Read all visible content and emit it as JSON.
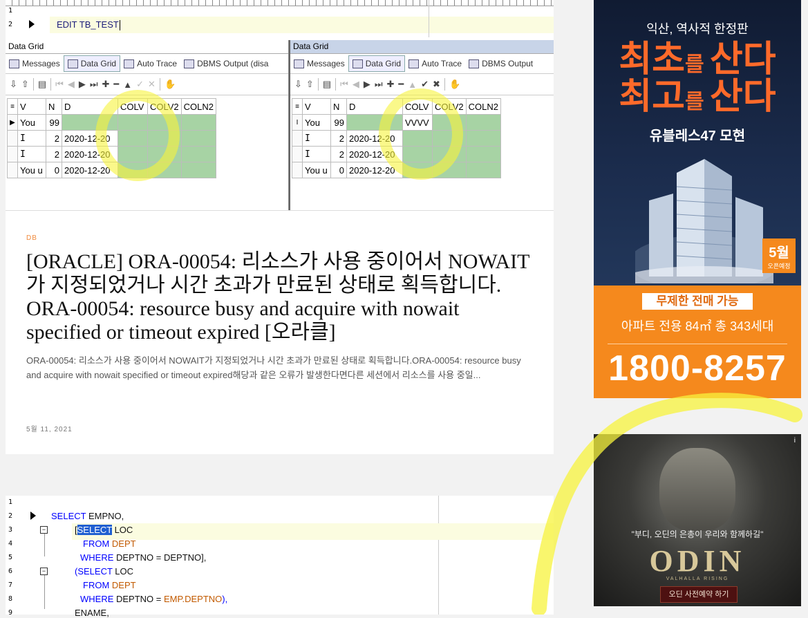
{
  "post1": {
    "category": "DB",
    "title": "[ORACLE] ORA-00054: 리소스가 사용 중이어서 NOWAIT가 지정되었거나 시간 초과가 만료된 상태로 획득합니다. ORA-00054: resource busy and acquire with nowait specified or timeout expired [오라클]",
    "excerpt": "ORA-00054: 리소스가 사용 중이어서 NOWAIT가 지정되었거나 시간 초과가 만료된 상태로 획득합니다.ORA-00054: resource busy and acquire with nowait specified or timeout expired해당과 같은 오류가 발생한다면다른 세션에서 리소스를 사용 중일...",
    "date": "5월 11, 2021",
    "editor": {
      "line1": "1",
      "line2": "2",
      "code": "EDIT TB_TEST"
    },
    "left_pane": {
      "title": "Data Grid",
      "tabs": [
        "Messages",
        "Data Grid",
        "Auto Trace",
        "DBMS Output (disa"
      ],
      "columns": [
        "V",
        "N",
        "D",
        "COLV",
        "COLV2",
        "COLN2"
      ],
      "rows": [
        [
          "You",
          "99",
          "",
          "",
          "",
          ""
        ],
        [
          "I",
          "2",
          "2020-12-20",
          "",
          "",
          ""
        ],
        [
          "I",
          "2",
          "2020-12-20",
          "",
          "",
          ""
        ],
        [
          "You u",
          "0",
          "2020-12-20",
          "",
          "",
          ""
        ]
      ]
    },
    "right_pane": {
      "title": "Data Grid",
      "tabs": [
        "Messages",
        "Data Grid",
        "Auto Trace",
        "DBMS Output"
      ],
      "columns": [
        "V",
        "N",
        "D",
        "COLV",
        "COLV2",
        "COLN2"
      ],
      "rows": [
        [
          "You",
          "99",
          "",
          "VVVV",
          "",
          ""
        ],
        [
          "I",
          "2",
          "2020-12-20",
          "",
          "",
          ""
        ],
        [
          "I",
          "2",
          "2020-12-20",
          "",
          "",
          ""
        ],
        [
          "You u",
          "0",
          "2020-12-20",
          "",
          "",
          ""
        ]
      ]
    }
  },
  "post2": {
    "line_numbers": [
      "1",
      "2",
      "3",
      "4",
      "5",
      "6",
      "7",
      "8",
      "9"
    ],
    "sql": {
      "l2_kw": "SELECT",
      "l2_id": " EMPNO,",
      "l3_sel": "SELECT",
      "l3_id": " LOC",
      "l4_kw": "FROM",
      "l4_obj": " DEPT",
      "l5_kw": "WHERE",
      "l5_id": " DEPTNO = DEPTNO",
      "l6_kw": "(SELECT",
      "l6_id": " LOC",
      "l7_kw": "FROM",
      "l7_obj": " DEPT",
      "l8_kw": "WHERE",
      "l8_id": " DEPTNO = ",
      "l8_obj": "EMP.DEPTNO",
      "l9_id": "ENAME,"
    }
  },
  "ad1": {
    "subtitle": "익산, 역사적 한정판",
    "line1_big": "최초",
    "line1_small": "를 ",
    "line1_end": "산다",
    "line2_big": "최고",
    "line2_small": "를 ",
    "line2_end": "산다",
    "brand": "유블레스47 모현",
    "month": "5월",
    "month_sub": "오픈예정",
    "box": "무제한 전매 가능",
    "info": "아파트 전용 84㎡ 총 343세대",
    "phone": "1800-8257"
  },
  "ad2": {
    "info_mark": "i",
    "quote": "\"부디, 오딘의 은총이 우리와 함께하길\"",
    "logo": "ODIN",
    "logo_sub": "VALHALLA RISING",
    "button": "오딘 사전예약 하기"
  },
  "colors": {
    "accent": "#f08a3c",
    "grid_green": "#a7d3a4",
    "highlighter": "#f7f33c",
    "ad_orange": "#f5891d"
  }
}
